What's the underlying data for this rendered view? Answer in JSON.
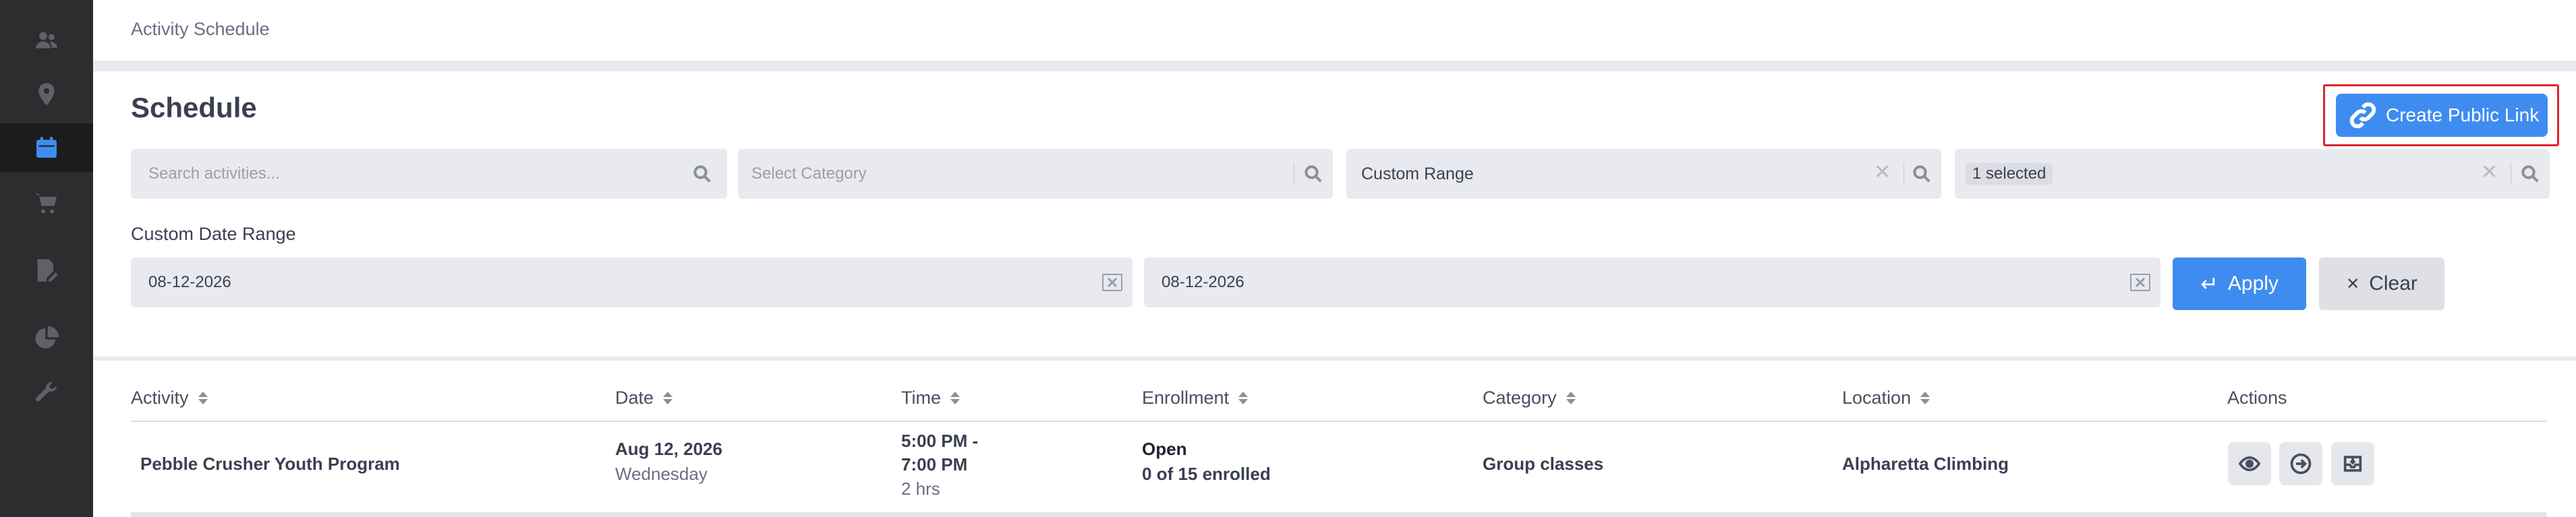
{
  "breadcrumb": "Activity Schedule",
  "page_title": "Schedule",
  "create_public_link_label": "Create Public Link",
  "filters": {
    "search_placeholder": "Search activities...",
    "category_placeholder": "Select Category",
    "date_range_value": "Custom Range",
    "location_chip": "1 selected"
  },
  "custom_date_range": {
    "label": "Custom Date Range",
    "start": "08-12-2026",
    "end": "08-12-2026"
  },
  "actions": {
    "apply_label": "Apply",
    "clear_label": "Clear"
  },
  "table": {
    "headers": [
      "Activity",
      "Date",
      "Time",
      "Enrollment",
      "Category",
      "Location",
      "Actions"
    ],
    "rows": [
      {
        "activity": "Pebble Crusher Youth Program",
        "date": "Aug 12, 2026",
        "weekday": "Wednesday",
        "time_start": "5:00 PM -",
        "time_end": "7:00 PM",
        "duration": "2 hrs",
        "enrollment_status": "Open",
        "enrollment_count": "0 of 15 enrolled",
        "category": "Group classes",
        "location": "Alpharetta Climbing"
      }
    ]
  },
  "icons": {
    "sidebar": [
      "users-icon",
      "location-pin-icon",
      "calendar-icon",
      "cart-icon",
      "document-edit-icon",
      "pie-chart-icon",
      "wrench-icon"
    ],
    "row_actions": [
      "eye-icon",
      "sign-in-icon",
      "inbox-icon"
    ]
  },
  "colors": {
    "accent": "#3f8cf0",
    "sidebar_bg": "#2d2d2f",
    "highlight_border": "#e0242b"
  }
}
